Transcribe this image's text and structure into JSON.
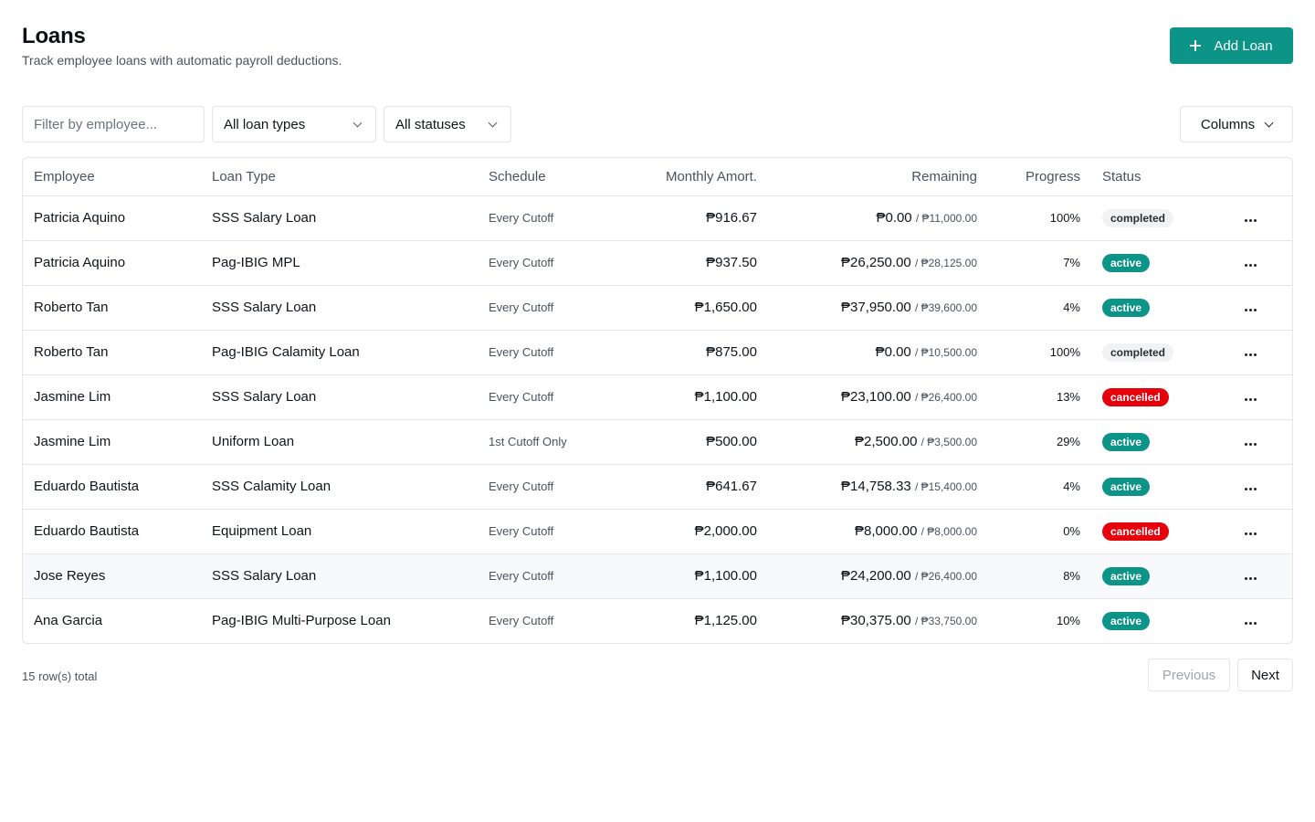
{
  "header": {
    "title": "Loans",
    "subtitle": "Track employee loans with automatic payroll deductions.",
    "add_label": "Add Loan"
  },
  "filters": {
    "employee_placeholder": "Filter by employee...",
    "employee_value": "",
    "loan_type": "All loan types",
    "status": "All statuses",
    "columns_label": "Columns"
  },
  "table": {
    "columns": [
      "Employee",
      "Loan Type",
      "Schedule",
      "Monthly Amort.",
      "Remaining",
      "Progress",
      "Status"
    ],
    "rows": [
      {
        "employee": "Patricia Aquino",
        "loan_type": "SSS Salary Loan",
        "schedule": "Every Cutoff",
        "monthly": "₱916.67",
        "remaining": "₱0.00",
        "total": "/ ₱11,000.00",
        "progress": "100%",
        "status": "completed"
      },
      {
        "employee": "Patricia Aquino",
        "loan_type": "Pag-IBIG MPL",
        "schedule": "Every Cutoff",
        "monthly": "₱937.50",
        "remaining": "₱26,250.00",
        "total": "/ ₱28,125.00",
        "progress": "7%",
        "status": "active"
      },
      {
        "employee": "Roberto Tan",
        "loan_type": "SSS Salary Loan",
        "schedule": "Every Cutoff",
        "monthly": "₱1,650.00",
        "remaining": "₱37,950.00",
        "total": "/ ₱39,600.00",
        "progress": "4%",
        "status": "active"
      },
      {
        "employee": "Roberto Tan",
        "loan_type": "Pag-IBIG Calamity Loan",
        "schedule": "Every Cutoff",
        "monthly": "₱875.00",
        "remaining": "₱0.00",
        "total": "/ ₱10,500.00",
        "progress": "100%",
        "status": "completed"
      },
      {
        "employee": "Jasmine Lim",
        "loan_type": "SSS Salary Loan",
        "schedule": "Every Cutoff",
        "monthly": "₱1,100.00",
        "remaining": "₱23,100.00",
        "total": "/ ₱26,400.00",
        "progress": "13%",
        "status": "cancelled"
      },
      {
        "employee": "Jasmine Lim",
        "loan_type": "Uniform Loan",
        "schedule": "1st Cutoff Only",
        "monthly": "₱500.00",
        "remaining": "₱2,500.00",
        "total": "/ ₱3,500.00",
        "progress": "29%",
        "status": "active"
      },
      {
        "employee": "Eduardo Bautista",
        "loan_type": "SSS Calamity Loan",
        "schedule": "Every Cutoff",
        "monthly": "₱641.67",
        "remaining": "₱14,758.33",
        "total": "/ ₱15,400.00",
        "progress": "4%",
        "status": "active"
      },
      {
        "employee": "Eduardo Bautista",
        "loan_type": "Equipment Loan",
        "schedule": "Every Cutoff",
        "monthly": "₱2,000.00",
        "remaining": "₱8,000.00",
        "total": "/ ₱8,000.00",
        "progress": "0%",
        "status": "cancelled"
      },
      {
        "employee": "Jose Reyes",
        "loan_type": "SSS Salary Loan",
        "schedule": "Every Cutoff",
        "monthly": "₱1,100.00",
        "remaining": "₱24,200.00",
        "total": "/ ₱26,400.00",
        "progress": "8%",
        "status": "active"
      },
      {
        "employee": "Ana Garcia",
        "loan_type": "Pag-IBIG Multi-Purpose Loan",
        "schedule": "Every Cutoff",
        "monthly": "₱1,125.00",
        "remaining": "₱30,375.00",
        "total": "/ ₱33,750.00",
        "progress": "10%",
        "status": "active"
      }
    ],
    "hovered_row": 8
  },
  "footer": {
    "row_count": "15 row(s) total",
    "previous_label": "Previous",
    "next_label": "Next"
  },
  "colors": {
    "accent": "#0d9488",
    "cancelled": "#e7000b",
    "completed_bg": "#f1f2f4"
  },
  "icons": {
    "add": "plus-icon",
    "dropdown": "chevron-down-icon",
    "row_actions": "more-horizontal-icon"
  }
}
